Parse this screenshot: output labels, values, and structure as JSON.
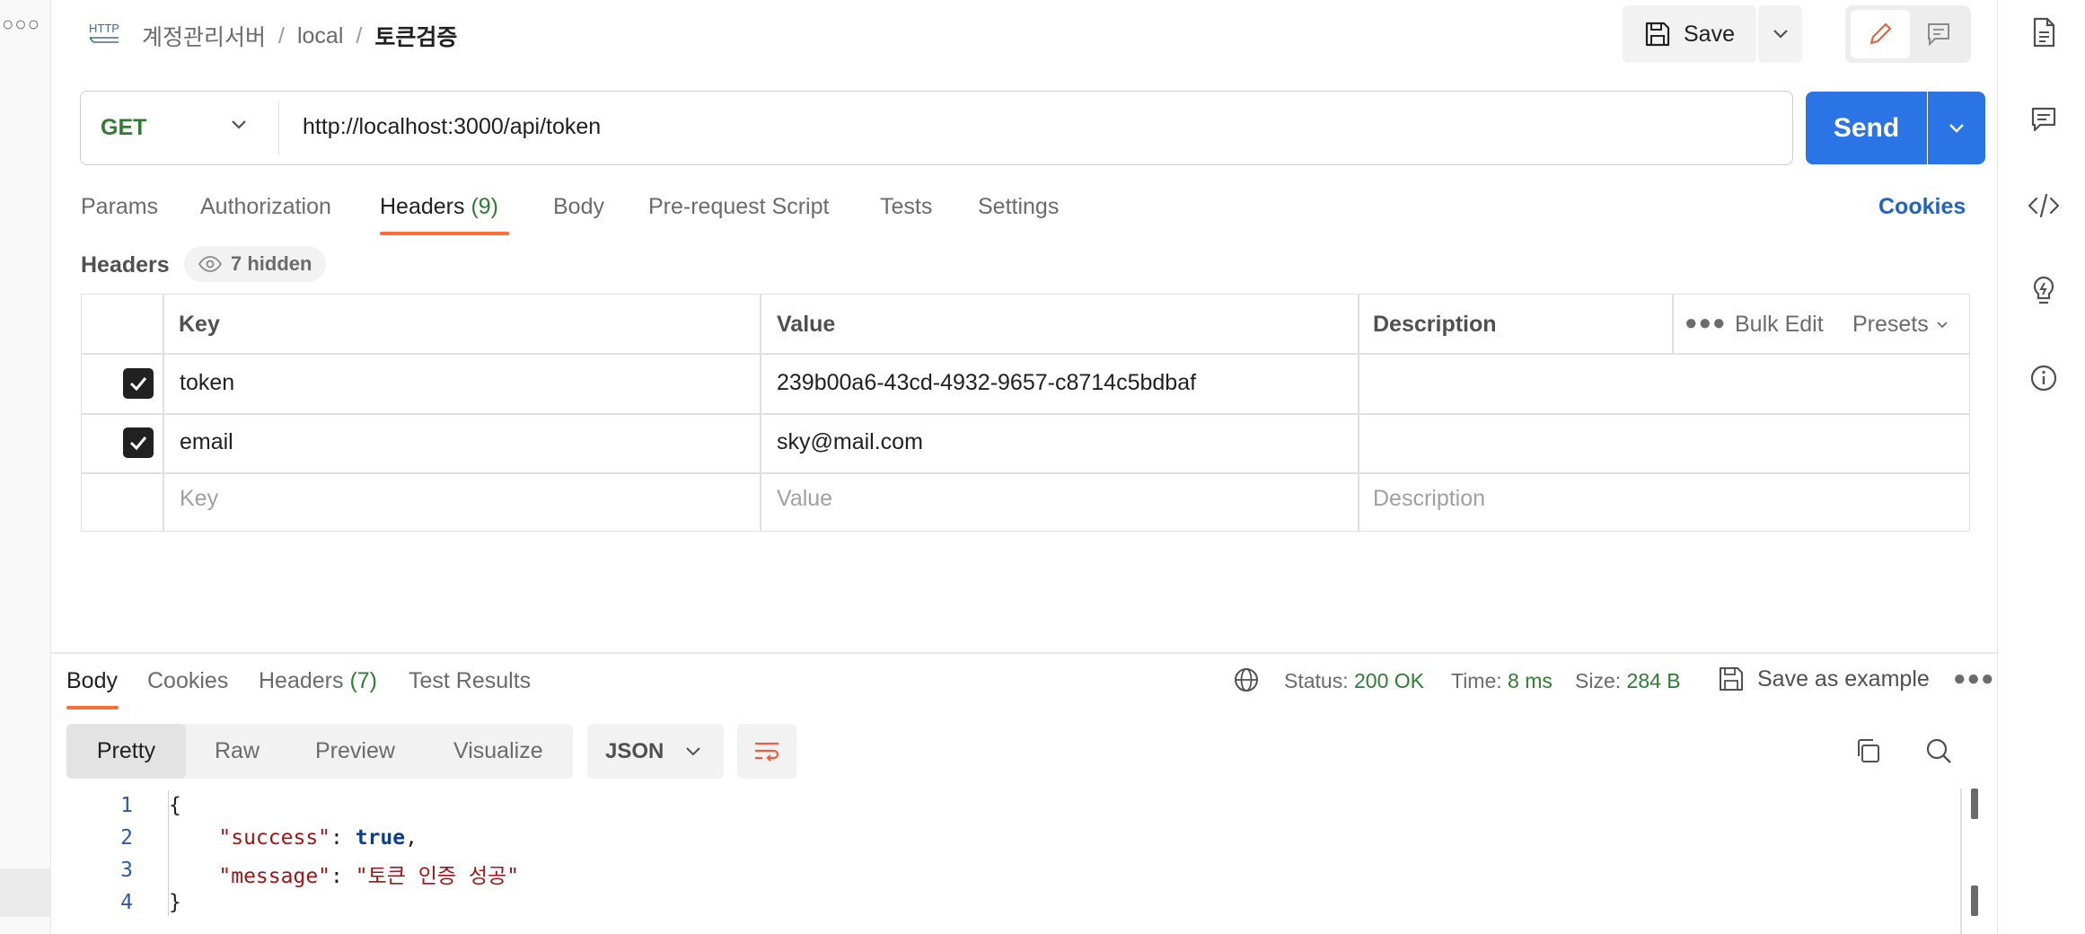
{
  "left": {
    "more_glyph": "○○○"
  },
  "breadcrumb": {
    "icon_text": "HTTP",
    "items": [
      "계정관리서버",
      "local",
      "토큰검증"
    ],
    "separator": "/"
  },
  "toolbar": {
    "save_label": "Save"
  },
  "request": {
    "method": "GET",
    "url": "http://localhost:3000/api/token",
    "send_label": "Send"
  },
  "request_tabs": {
    "items": [
      {
        "label": "Params"
      },
      {
        "label": "Authorization"
      },
      {
        "label": "Headers",
        "count": "(9)"
      },
      {
        "label": "Body"
      },
      {
        "label": "Pre-request Script"
      },
      {
        "label": "Tests"
      },
      {
        "label": "Settings"
      }
    ],
    "active": "Headers",
    "cookies_label": "Cookies"
  },
  "headers_section": {
    "title": "Headers",
    "hidden_label": "7 hidden",
    "columns": [
      "Key",
      "Value",
      "Description"
    ],
    "bulk_edit": "Bulk Edit",
    "presets": "Presets",
    "rows": [
      {
        "key": "token",
        "value": "239b00a6-43cd-4932-9657-c8714c5bdbaf",
        "description": "",
        "checked": true
      },
      {
        "key": "email",
        "value": "sky@mail.com",
        "description": "",
        "checked": true
      }
    ],
    "placeholders": {
      "key": "Key",
      "value": "Value",
      "description": "Description"
    }
  },
  "response": {
    "tabs": [
      {
        "label": "Body"
      },
      {
        "label": "Cookies"
      },
      {
        "label": "Headers",
        "count": "(7)"
      },
      {
        "label": "Test Results"
      }
    ],
    "active": "Body",
    "status_label": "Status:",
    "status_value": "200 OK",
    "time_label": "Time:",
    "time_value": "8 ms",
    "size_label": "Size:",
    "size_value": "284 B",
    "save_example": "Save as example",
    "formats": [
      "Pretty",
      "Raw",
      "Preview",
      "Visualize"
    ],
    "active_format": "Pretty",
    "language": "JSON",
    "code": {
      "line_numbers": [
        "1",
        "2",
        "3",
        "4"
      ],
      "open_brace": "{",
      "close_brace": "}",
      "success_key": "\"success\"",
      "success_value": "true",
      "message_key": "\"message\"",
      "message_value": "\"토큰 인증 성공\""
    }
  },
  "colors": {
    "accent": "#ff6c37",
    "send": "#2b74e6",
    "status_ok": "#2e7d32",
    "link": "#1d63c9"
  }
}
